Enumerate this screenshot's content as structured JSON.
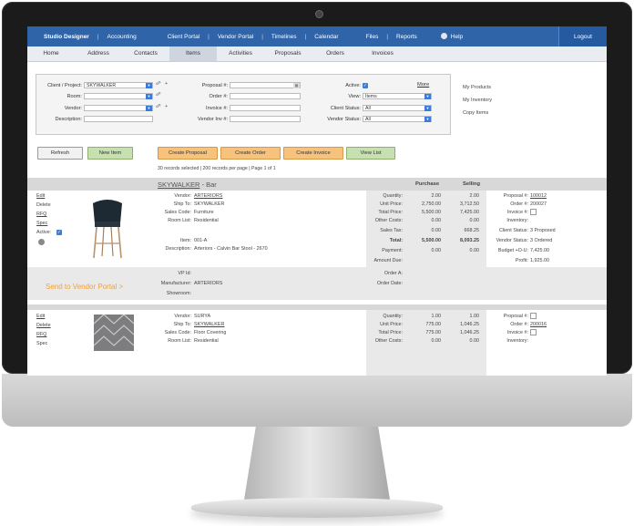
{
  "nav": {
    "items": [
      "Studio Designer",
      "Accounting",
      "Client Portal",
      "Vendor Portal",
      "Timelines",
      "Calendar",
      "Files",
      "Reports",
      "Help",
      "Logout"
    ],
    "tabs": [
      "Home",
      "Address",
      "Contacts",
      "Items",
      "Activities",
      "Proposals",
      "Orders",
      "Invoices"
    ],
    "active_tab": "Items"
  },
  "filter": {
    "client_project_label": "Client / Project:",
    "client_project_value": "SKYWALKER",
    "room_label": "Room:",
    "vendor_label": "Vendor:",
    "description_label": "Description:",
    "proposal_label": "Proposal #:",
    "order_label": "Order #:",
    "invoice_label": "Invoice #:",
    "vendor_inv_label": "Vendor Inv #:",
    "active_label": "Active:",
    "more_label": "More",
    "view_label": "View:",
    "view_value": "Items",
    "client_status_label": "Client Status:",
    "client_status_value": "All",
    "vendor_status_label": "Vendor Status:",
    "vendor_status_value": "All"
  },
  "side_links": [
    "My Products",
    "My Inventory",
    "Copy Items"
  ],
  "buttons": {
    "refresh": "Refresh",
    "new_item": "New Item",
    "create_proposal": "Create Proposal",
    "create_order": "Create Order",
    "create_invoice": "Create Invoice",
    "view_list": "View List"
  },
  "records_info": "30 records selected | 200 records per page | Page 1 of 1",
  "columns": {
    "purchase": "Purchase",
    "selling": "Selling"
  },
  "item1": {
    "title_link": "SKYWALKER",
    "title_rest": " - Bar",
    "actions": [
      "Edit",
      "Delete",
      "RFQ",
      "Spec"
    ],
    "active_label": "Active:",
    "vendor_label": "Vendor:",
    "vendor": "ARTERIORS",
    "ship_to_label": "Ship To:",
    "ship_to": "SKYWALKER",
    "sales_code_label": "Sales Code:",
    "sales_code": "Furniture",
    "room_list_label": "Room List:",
    "room_list": "Residential",
    "item_label": "Item:",
    "item": "001-A",
    "description_label": "Description:",
    "description": "Arteriors - Calvin Bar Stool - 2670",
    "quantity_label": "Quantity:",
    "quantity_p": "2.00",
    "quantity_s": "2.00",
    "unit_price_label": "Unit Price:",
    "unit_price_p": "2,750.00",
    "unit_price_s": "3,712.50",
    "total_price_label": "Total Price:",
    "total_price_p": "5,500.00",
    "total_price_s": "7,425.00",
    "other_costs_label": "Other Costs:",
    "other_costs_p": "0.00",
    "other_costs_s": "0.00",
    "sales_tax_label": "Sales Tax:",
    "sales_tax_p": "0.00",
    "sales_tax_s": "668.25",
    "total_label": "Total:",
    "total_p": "5,500.00",
    "total_s": "8,093.25",
    "payment_label": "Payment:",
    "payment_p": "0.00",
    "payment_s": "0.00",
    "amount_due_label": "Amount Due:",
    "proposal_label": "Proposal #:",
    "proposal": "100012",
    "order_label": "Order #:",
    "order": "200027",
    "invoice_label": "Invoice #:",
    "inventory_label": "Inventory:",
    "client_status_label": "Client Status:",
    "client_status": "3 Proposed",
    "vendor_status_label": "Vendor Status:",
    "vendor_status": "3 Ordered",
    "budget_label": "Budget +O-U:",
    "budget": "7,425.00",
    "profit_label": "Profit:",
    "profit": "1,925.00",
    "vp_id_label": "VP Id:",
    "manufacturer_label": "Manufacturer:",
    "manufacturer": "ARTERIORS",
    "showroom_label": "Showroom:",
    "order_a_label": "Order A:",
    "order_date_label": "Order Date:",
    "send_vendor": "Send to Vendor Portal >"
  },
  "item2": {
    "actions": [
      "Edit",
      "Delete",
      "RFQ",
      "Spec"
    ],
    "vendor_label": "Vendor:",
    "vendor": "SURYA",
    "ship_to_label": "Ship To:",
    "ship_to": "SKYWALKER",
    "sales_code_label": "Sales Code:",
    "sales_code": "Floor Covering",
    "room_list_label": "Room List:",
    "room_list": "Residential",
    "quantity_label": "Quantity:",
    "quantity_p": "1.00",
    "quantity_s": "1.00",
    "unit_price_label": "Unit Price:",
    "unit_price_p": "775.00",
    "unit_price_s": "1,046.25",
    "total_price_label": "Total Price:",
    "total_price_p": "775.00",
    "total_price_s": "1,046.25",
    "other_costs_label": "Other Costs:",
    "other_costs_p": "0.00",
    "other_costs_s": "0.00",
    "proposal_label": "Proposal #:",
    "order_label": "Order #:",
    "order": "200016",
    "invoice_label": "Invoice #:",
    "inventory_label": "Inventory:"
  },
  "colors": {
    "nav_blue": "#2f64a8",
    "accent_orange": "#f7c27c",
    "accent_green": "#c6e0b0",
    "send_orange": "#f0a23a"
  }
}
